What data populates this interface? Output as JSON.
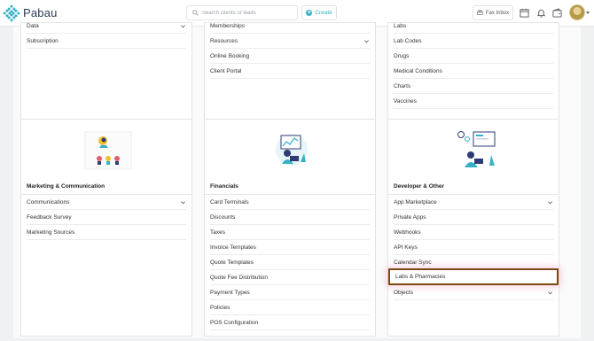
{
  "header": {
    "logo_text": "Pabau",
    "search_placeholder": "Search clients or leads",
    "create_label": "Create",
    "fax_label": "Fax Inbox",
    "icons": [
      "calendar-icon",
      "bell-icon",
      "wallet-icon",
      "avatar"
    ]
  },
  "columns": {
    "col1": {
      "top_rows": [
        "Data",
        "Subscription"
      ],
      "bottom_title": "Marketing & Communication",
      "bottom_rows": [
        "Communications",
        "Feedback Survey",
        "Marketing Sources"
      ]
    },
    "col2": {
      "top_rows": [
        "Memberships",
        "Resources",
        "Online Booking",
        "Client Portal"
      ],
      "bottom_title": "Financials",
      "bottom_rows": [
        "Card Terminals",
        "Discounts",
        "Taxes",
        "Invoice Templates",
        "Quote Templates",
        "Quote Fee Distribution",
        "Payment Types",
        "Policies",
        "POS Configuration"
      ]
    },
    "col3": {
      "top_rows": [
        "Labs",
        "Lab Codes",
        "Drugs",
        "Medical Conditions",
        "Charts",
        "Vaccines"
      ],
      "bottom_title": "Developer & Other",
      "bottom_rows": [
        "App Marketplace",
        "Private Apps",
        "Webhooks",
        "API Keys",
        "Calendar Sync",
        "Labs & Pharmacies",
        "Objects"
      ]
    }
  },
  "colors": {
    "accent": "#35b1c6",
    "highlight_border": "#7a4a12"
  }
}
